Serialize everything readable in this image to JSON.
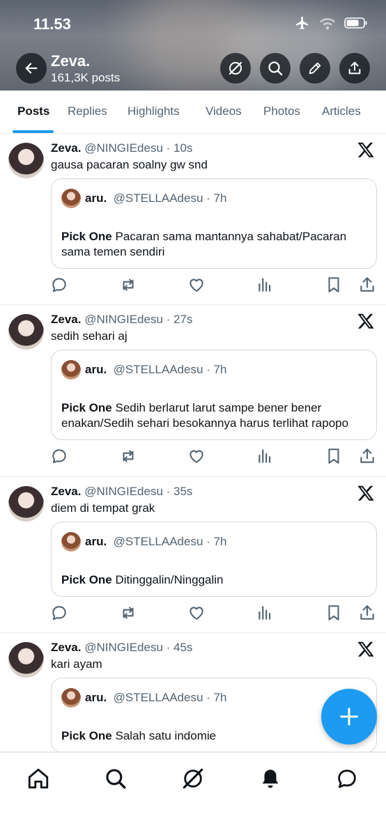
{
  "status": {
    "time": "11.53"
  },
  "profile": {
    "name": "Zeva.",
    "posts_count": "161,3K posts"
  },
  "tabs": [
    "Posts",
    "Replies",
    "Highlights",
    "Videos",
    "Photos",
    "Articles"
  ],
  "posts": [
    {
      "name": "Zeva.",
      "handle": "@NINGIEdesu",
      "time": "· 10s",
      "text": "gausa pacaran soalny gw snd",
      "quote": {
        "name": "aru.",
        "handle": "@STELLAAdesu",
        "time": "· 7h",
        "label": "Pick One",
        "text": "Pacaran sama mantannya sahabat/Pacaran sama temen sendiri"
      }
    },
    {
      "name": "Zeva.",
      "handle": "@NINGIEdesu",
      "time": "· 27s",
      "text": "sedih sehari aj",
      "quote": {
        "name": "aru.",
        "handle": "@STELLAAdesu",
        "time": "· 7h",
        "label": "Pick One",
        "text": "Sedih berlarut larut sampe bener bener enakan/Sedih sehari besokannya harus terlihat rapopo"
      }
    },
    {
      "name": "Zeva.",
      "handle": "@NINGIEdesu",
      "time": "· 35s",
      "text": "diem di tempat grak",
      "quote": {
        "name": "aru.",
        "handle": "@STELLAAdesu",
        "time": "· 7h",
        "label": "Pick One",
        "text": "Ditinggalin/Ninggalin"
      }
    },
    {
      "name": "Zeva.",
      "handle": "@NINGIEdesu",
      "time": "· 45s",
      "text": "kari ayam",
      "quote": {
        "name": "aru.",
        "handle": "@STELLAAdesu",
        "time": "· 7h",
        "label": "Pick One",
        "text": "Salah satu indomie"
      }
    }
  ],
  "colors": {
    "accent": "#1d9bf0",
    "text": "#0f1419",
    "secondary": "#536471",
    "border": "#cfd9de"
  },
  "icons": [
    "back-arrow-icon",
    "grok-icon",
    "search-icon",
    "edit-icon",
    "share-icon",
    "x-logo-icon",
    "reply-icon",
    "repost-icon",
    "like-icon",
    "views-icon",
    "bookmark-icon",
    "home-icon",
    "bell-icon",
    "messages-icon",
    "plus-icon"
  ]
}
